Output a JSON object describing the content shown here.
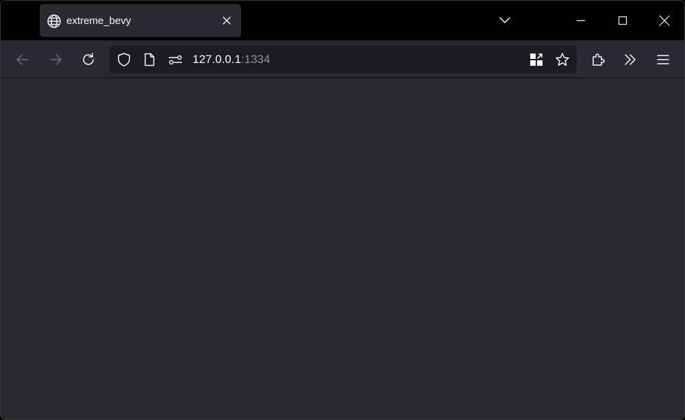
{
  "tab": {
    "title": "extreme_bevy",
    "favicon": "globe-icon"
  },
  "address_bar": {
    "host": "127.0.0.1",
    "port": ":1334"
  },
  "icons": {
    "back": "arrow-left-icon",
    "forward": "arrow-right-icon",
    "reload": "reload-icon",
    "shield": "shield-icon",
    "page": "page-icon",
    "permissions": "permissions-icon",
    "qr": "qr-code-icon",
    "bookmark": "star-icon",
    "extensions": "puzzle-icon",
    "overflow": "chevrons-right-icon",
    "menu": "hamburger-icon",
    "tab_list": "chevron-down-icon",
    "minimize": "minimize-icon",
    "maximize": "maximize-icon",
    "close": "close-icon"
  },
  "colors": {
    "titlebar": "#000000",
    "toolbar": "#2b2a33",
    "urlbar": "#1c1b22",
    "content": "#2a2a2e",
    "text": "#fbfbfe",
    "muted_text": "#8f8f9d"
  }
}
